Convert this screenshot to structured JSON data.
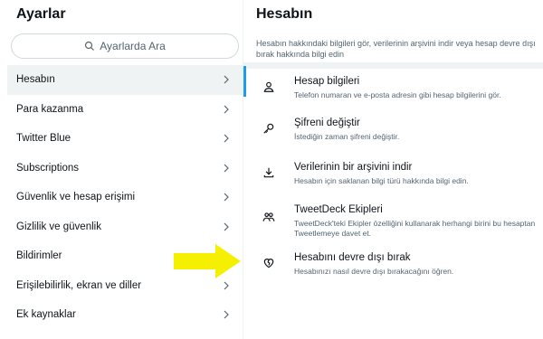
{
  "left": {
    "title": "Ayarlar",
    "search_placeholder": "Ayarlarda Ara",
    "items": [
      {
        "label": "Hesabın"
      },
      {
        "label": "Para kazanma"
      },
      {
        "label": "Twitter Blue"
      },
      {
        "label": "Subscriptions"
      },
      {
        "label": "Güvenlik ve hesap erişimi"
      },
      {
        "label": "Gizlilik ve güvenlik"
      },
      {
        "label": "Bildirimler"
      },
      {
        "label": "Erişilebilirlik, ekran ve diller"
      },
      {
        "label": "Ek kaynaklar"
      }
    ]
  },
  "right": {
    "title": "Hesabın",
    "description": "Hesabın hakkındaki bilgileri gör, verilerinin arşivini indir veya hesap devre dışı bırak hakkında bilgi edin",
    "items": [
      {
        "title": "Hesap bilgileri",
        "subtitle": "Telefon numaran ve e-posta adresin gibi hesap bilgilerini gör.",
        "icon": "person-icon"
      },
      {
        "title": "Şifreni değiştir",
        "subtitle": "İstediğin zaman şifreni değiştir.",
        "icon": "key-icon"
      },
      {
        "title": "Verilerinin bir arşivini indir",
        "subtitle": "Hesabın için saklanan bilgi türü hakkında bilgi edin.",
        "icon": "download-icon"
      },
      {
        "title": "TweetDeck Ekipleri",
        "subtitle": "TweetDeck'teki Ekipler özelliğini kullanarak herhangi birini bu hesaptan Tweetlemeye davet et.",
        "icon": "team-icon"
      },
      {
        "title": "Hesabını devre dışı bırak",
        "subtitle": "Hesabınızı nasıl devre dışı bırakacağını öğren.",
        "icon": "broken-heart-icon"
      }
    ]
  },
  "colors": {
    "accent": "#1d9bf0",
    "arrow": "#f5f000",
    "active_bg": "#eff3f4"
  }
}
